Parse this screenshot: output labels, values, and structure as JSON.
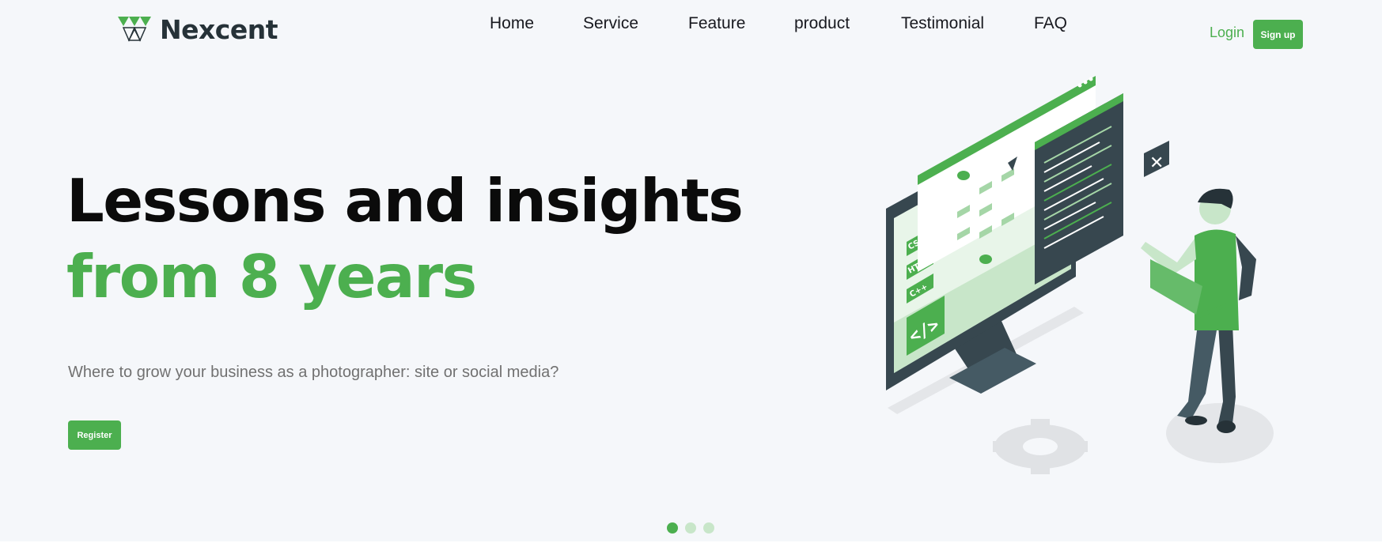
{
  "brand": {
    "name": "Nexcent"
  },
  "nav": {
    "items": [
      {
        "label": "Home"
      },
      {
        "label": "Service"
      },
      {
        "label": "Feature"
      },
      {
        "label": "product"
      },
      {
        "label": "Testimonial"
      },
      {
        "label": "FAQ"
      }
    ],
    "login_label": "Login",
    "signup_label": "Sign up"
  },
  "hero": {
    "headline_line1": "Lessons and insights",
    "headline_line2": "from 8 years",
    "subtitle": "Where to grow your business as a photographer: site or social media?",
    "register_label": "Register",
    "illustration_labels": {
      "css": "CSS",
      "html": "HTML",
      "cpp": "C++"
    }
  },
  "carousel": {
    "slides": 3,
    "active_index": 0
  },
  "colors": {
    "accent": "#4caf4f",
    "background": "#f5f7fa",
    "heading": "#0b0b0b",
    "text_gray": "#717171",
    "dark": "#263238",
    "dot_inactive": "#c8e6c9"
  }
}
